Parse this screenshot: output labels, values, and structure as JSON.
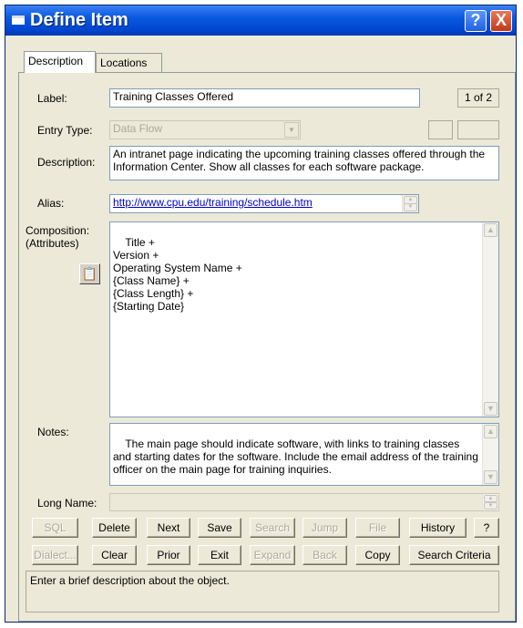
{
  "window": {
    "title": "Define Item",
    "help_label": "?",
    "close_label": "X"
  },
  "tabs": [
    {
      "label": "Description",
      "active": true
    },
    {
      "label": "Locations",
      "active": false
    }
  ],
  "form": {
    "label_caption": "Label:",
    "label_value": "Training Classes Offered",
    "page_indicator": "1 of 2",
    "entry_type_caption": "Entry Type:",
    "entry_type_value": "Data Flow",
    "description_caption": "Description:",
    "description_value": "An intranet page indicating the upcoming training classes offered through the Information Center. Show all classes for each software package.",
    "alias_caption": "Alias:",
    "alias_value": "http://www.cpu.edu/training/schedule.htm",
    "composition_caption": "Composition:",
    "composition_caption2": "(Attributes)",
    "composition_value": "Title +\nVersion +\nOperating System Name +\n{Class Name} +\n{Class Length} +\n{Starting Date}",
    "notes_caption": "Notes:",
    "notes_value": "The main page should indicate software, with links to training classes and starting dates for the software. Include the email address of the training officer on the main page for training inquiries.",
    "long_name_caption": "Long Name:",
    "long_name_value": ""
  },
  "buttons_row1": [
    {
      "label": "SQL",
      "enabled": false
    },
    {
      "label": "Delete",
      "enabled": true
    },
    {
      "label": "Next",
      "enabled": true
    },
    {
      "label": "Save",
      "enabled": true
    },
    {
      "label": "Search",
      "enabled": false
    },
    {
      "label": "Jump",
      "enabled": false
    },
    {
      "label": "File",
      "enabled": false
    },
    {
      "label": "History",
      "enabled": true
    },
    {
      "label": "?",
      "enabled": true
    }
  ],
  "buttons_row2": [
    {
      "label": "Dialect...",
      "enabled": false
    },
    {
      "label": "Clear",
      "enabled": true
    },
    {
      "label": "Prior",
      "enabled": true
    },
    {
      "label": "Exit",
      "enabled": true
    },
    {
      "label": "Expand",
      "enabled": false
    },
    {
      "label": "Back",
      "enabled": false
    },
    {
      "label": "Copy",
      "enabled": true
    },
    {
      "label": "Search Criteria",
      "enabled": true
    }
  ],
  "status_text": "Enter a brief description about the object.",
  "icons": {
    "window_icon": "window-icon",
    "attributes_icon": "clipboard-icon"
  }
}
